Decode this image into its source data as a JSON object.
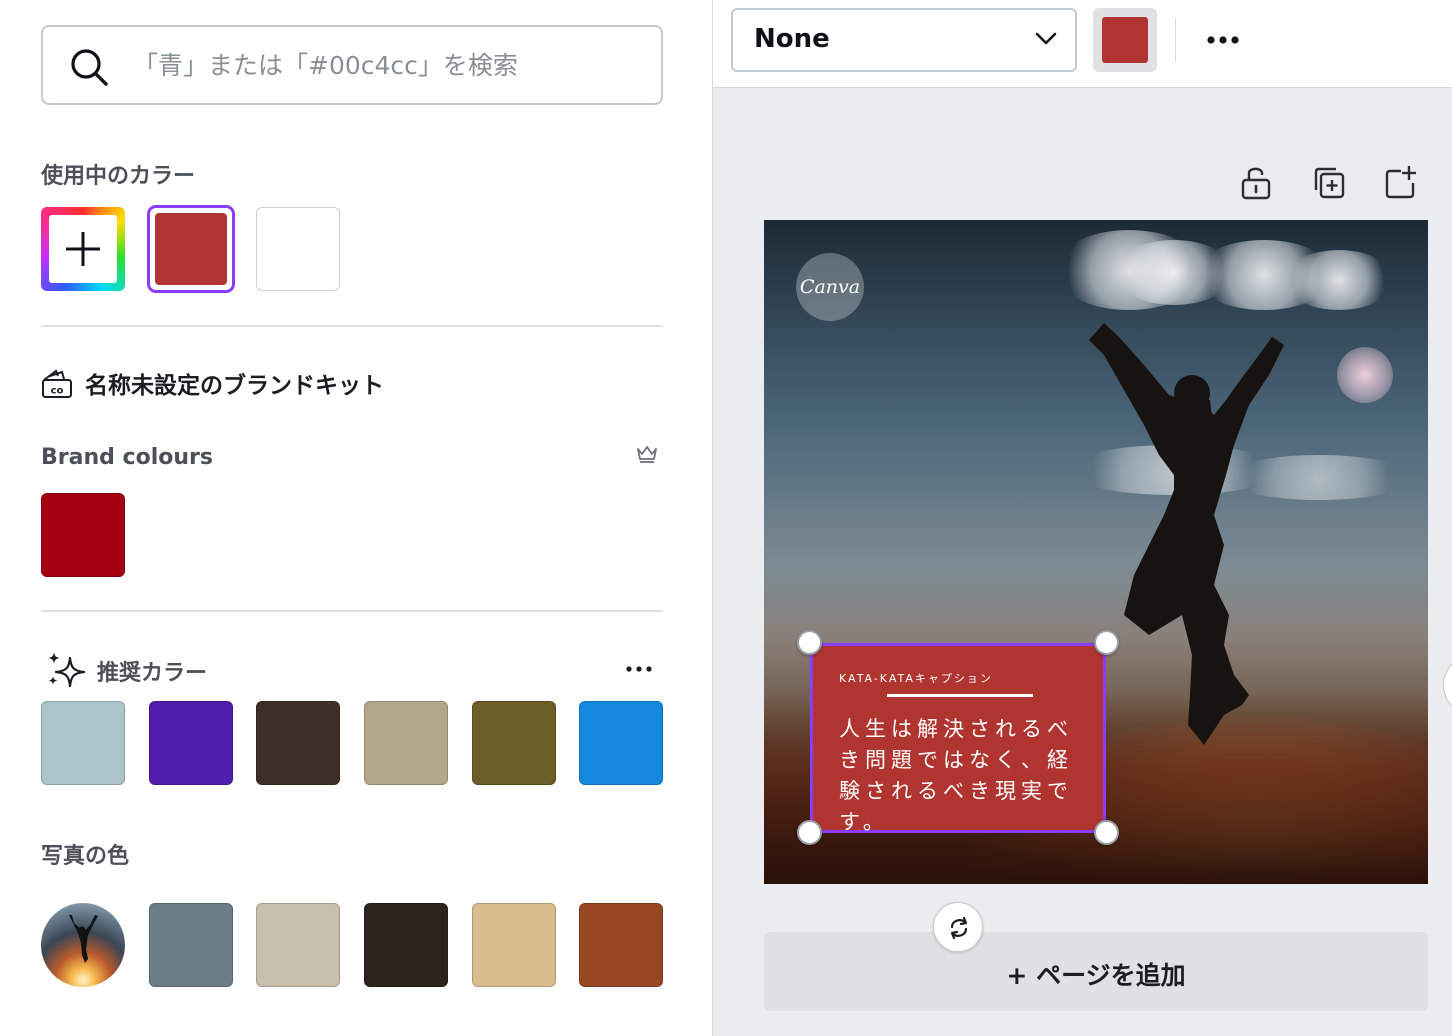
{
  "search": {
    "placeholder": "「青」または「#00c4cc」を検索"
  },
  "in_use": {
    "title": "使用中のカラー",
    "swatches": [
      {
        "name": "add-color",
        "color": "rainbow"
      },
      {
        "name": "red",
        "color": "#b03530",
        "selected": true
      },
      {
        "name": "white",
        "color": "#ffffff"
      }
    ]
  },
  "brand_kit": {
    "title": "名称未設定のブランドキット",
    "icon": "brand-kit-icon"
  },
  "brand_colours": {
    "title": "Brand colours",
    "badge_icon": "crown-icon",
    "swatches": [
      "#a4000f"
    ]
  },
  "suggested": {
    "title": "推奨カラー",
    "icon": "sparkle-icon",
    "menu_icon": "more-icon",
    "swatches": [
      "#adc4cc",
      "#4f1eab",
      "#3d2f28",
      "#b4a68b",
      "#6b5e27",
      "#1589dc"
    ]
  },
  "photo_colors": {
    "title": "写真の色",
    "swatches": [
      "#6b7d86",
      "#c8bfac",
      "#2c231e",
      "#d9bc8c",
      "#974722"
    ]
  },
  "toolbar": {
    "font_select": "None",
    "color_chip": "#b03530",
    "more_icon": "more-icon"
  },
  "canvas_actions": [
    "lock-icon",
    "duplicate-page-icon",
    "add-page-icon"
  ],
  "design": {
    "badge": "Canva",
    "caption": "KATA-KATAキャプション",
    "body": "人生は解決されるべき問題ではなく、経験されるべき現実です。",
    "box_color": "#b03530"
  },
  "add_page": {
    "label": "+ ページを追加"
  }
}
